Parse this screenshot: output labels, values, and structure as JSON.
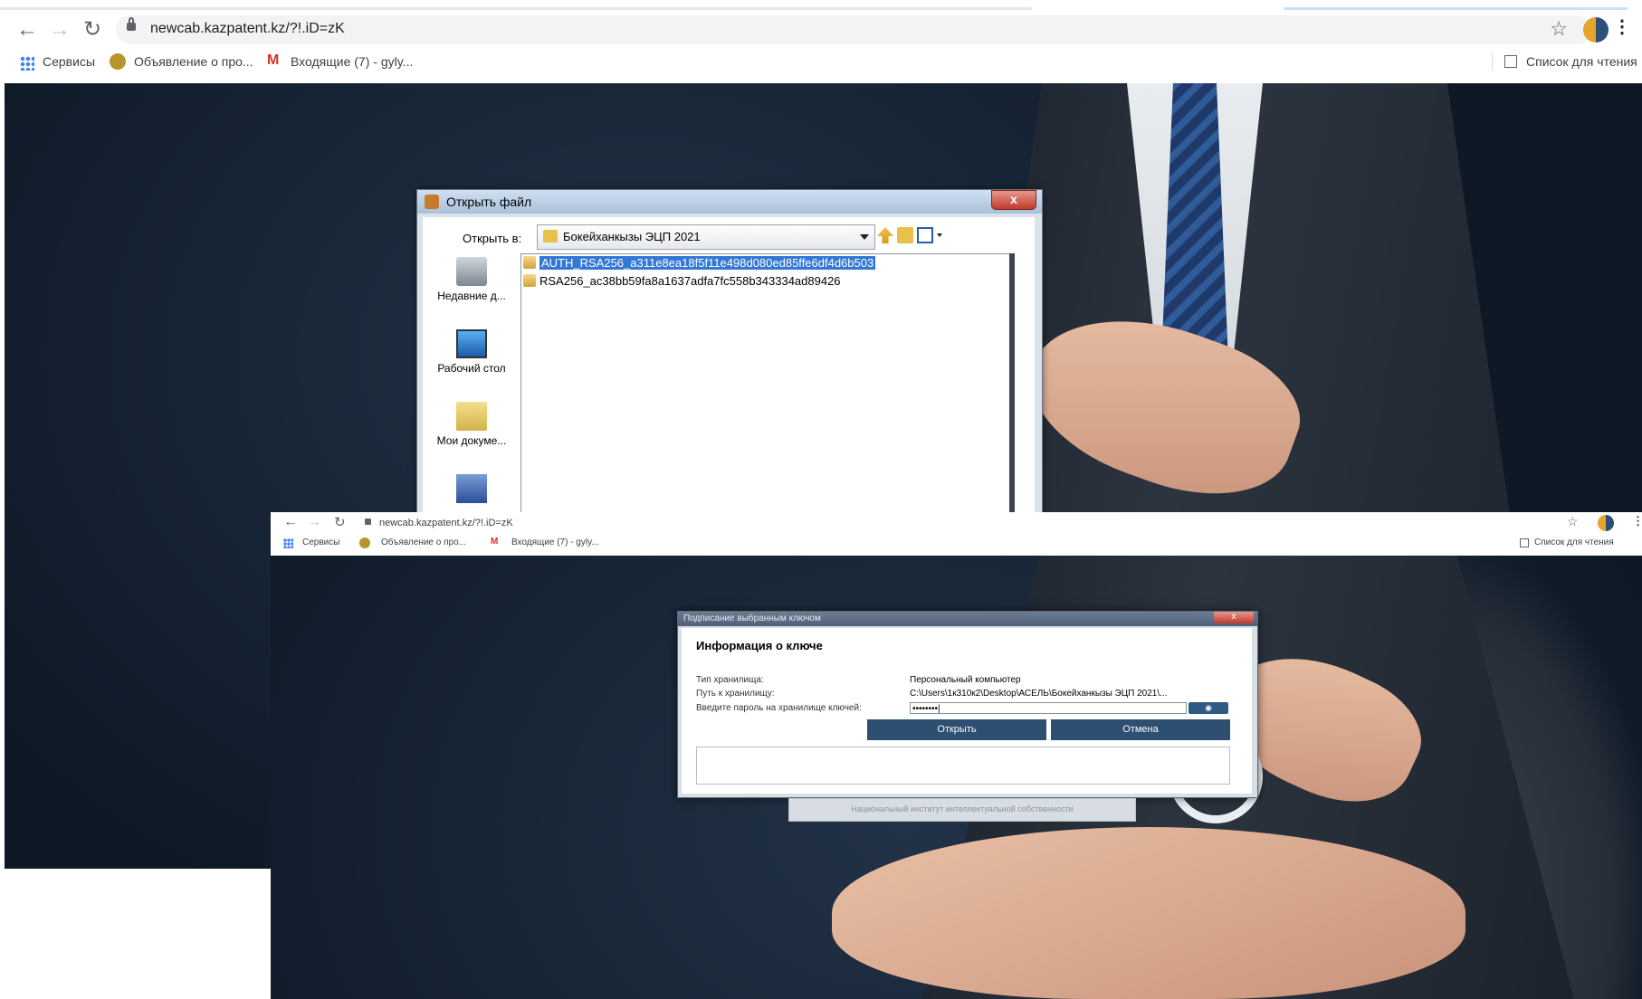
{
  "browser": {
    "url": "newcab.kazpatent.kz/?!.iD=zK",
    "bookmarks": [
      "Сервисы",
      "Объявление о про...",
      "Входящие (7) - gyly..."
    ],
    "reading_list": "Список для чтения"
  },
  "file_dialog": {
    "title": "Открыть файл",
    "look_in_label": "Открыть в:",
    "look_in_value": "Бокейханкызы ЭЦП 2021",
    "places": [
      "Недавние д...",
      "Рабочий стол",
      "Мои докуме..."
    ],
    "files": [
      "AUTH_RSA256_a311e8ea18f5f11e498d080ed85ffe6df4d6b503",
      "RSA256_ac38bb59fa8a1637adfa7fc558b343334ad89426"
    ],
    "selected_index": 0,
    "close_label": "x"
  },
  "second_browser": {
    "url": "newcab.kazpatent.kz/?!.iD=zK",
    "bookmarks": [
      "Сервисы",
      "Объявление о про...",
      "Входящие (7) - gyly..."
    ],
    "reading_list": "Список для чтения"
  },
  "key_dialog": {
    "title": "Подписание выбранным ключом",
    "heading": "Информация о ключе",
    "storage_type_label": "Тип хранилища:",
    "storage_type_value": "Персональный компьютер",
    "storage_path_label": "Путь к хранилищу:",
    "storage_path_value": "C:\\Users\\1к310к2\\Desktop\\АСЕЛЬ\\Бокейханкызы ЭЦП 2021\\...",
    "password_label": "Введите пароль на хранилище ключей:",
    "password_value": "••••••••|",
    "open_button": "Открыть",
    "cancel_button": "Отмена",
    "close_label": "x"
  },
  "footer": "Национальный институт интеллектуальной собственности",
  "colors": {
    "accent_button": "#2d4f72",
    "selection": "#3478d5"
  }
}
